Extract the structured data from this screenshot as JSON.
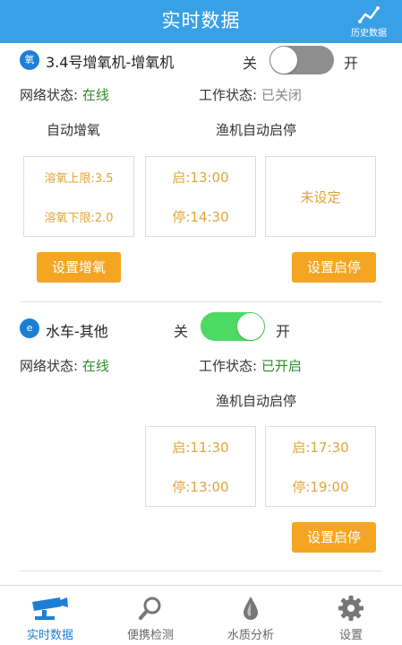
{
  "header": {
    "title": "实时数据",
    "history_label": "历史数据"
  },
  "devices": [
    {
      "icon_text": "氧",
      "name": "3.4号增氧机-增氧机",
      "switch_off_label": "关",
      "switch_on_label": "开",
      "switch_state": "off",
      "network_label": "网络状态: ",
      "network_value": "在线",
      "work_label": "工作状态: ",
      "work_value": "已关闭",
      "auto_oxygen_title": "自动增氧",
      "auto_start_title": "渔机自动启停",
      "oxygen_upper": "溶氧上限:3.5",
      "oxygen_lower": "溶氧下限:2.0",
      "schedule1_start": "启:13:00",
      "schedule1_stop": "停:14:30",
      "schedule2_text": "未设定",
      "set_oxygen_button": "设置增氧",
      "set_start_button": "设置启停"
    },
    {
      "icon_text": "e",
      "name": "水车-其他",
      "switch_off_label": "关",
      "switch_on_label": "开",
      "switch_state": "on",
      "network_label": "网络状态: ",
      "network_value": "在线",
      "work_label": "工作状态: ",
      "work_value": "已开启",
      "auto_start_title": "渔机自动启停",
      "schedule1_start": "启:11:30",
      "schedule1_stop": "停:13:00",
      "schedule2_start": "启:17:30",
      "schedule2_stop": "停:19:00",
      "set_start_button": "设置启停"
    }
  ],
  "tabs": [
    {
      "label": "实时数据",
      "icon": "camera-icon",
      "active": true
    },
    {
      "label": "便携检测",
      "icon": "search-icon",
      "active": false
    },
    {
      "label": "水质分析",
      "icon": "water-drop-icon",
      "active": false
    },
    {
      "label": "设置",
      "icon": "gear-icon",
      "active": false
    }
  ],
  "colors": {
    "header": "#3aa0e6",
    "accent_orange": "#f4a623",
    "online_green": "#2e8b2e",
    "switch_on": "#4cd964",
    "active_tab": "#1d7fd3"
  }
}
